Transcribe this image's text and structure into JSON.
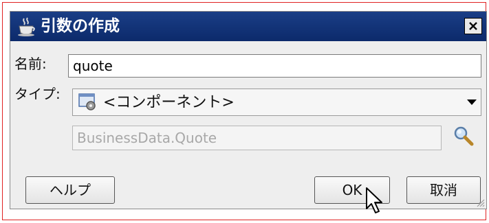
{
  "dialog": {
    "title": "引数の作成",
    "title_icon": "coffee-cup-icon",
    "close_icon": "close-x-icon"
  },
  "form": {
    "name_label": "名前:",
    "name_value": "quote",
    "type_label": "タイプ:",
    "type_icon": "component-gear-icon",
    "type_value": "<コンポーネント>",
    "class_value": "BusinessData.Quote",
    "search_icon": "magnifier-icon"
  },
  "buttons": {
    "help": "ヘルプ",
    "ok": "OK",
    "cancel": "取消"
  },
  "colors": {
    "titlebar": "#0c2a6b",
    "frame_border": "#e02020",
    "dialog_background": "#eeeeee"
  }
}
